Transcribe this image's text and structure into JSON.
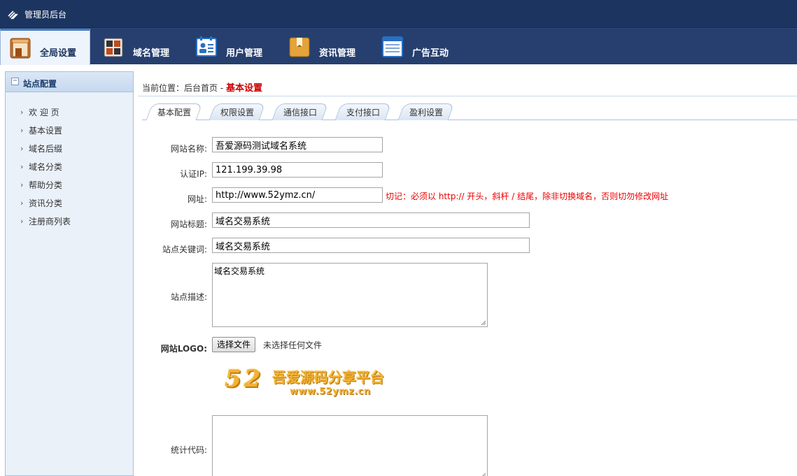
{
  "app": {
    "title": "管理员后台"
  },
  "nav": [
    {
      "label": "全局设置",
      "icon": "cabinet-icon",
      "active": true
    },
    {
      "label": "域名管理",
      "icon": "grid-icon",
      "active": false
    },
    {
      "label": "用户管理",
      "icon": "user-card-icon",
      "active": false
    },
    {
      "label": "资讯管理",
      "icon": "folder-icon",
      "active": false
    },
    {
      "label": "广告互动",
      "icon": "notepad-icon",
      "active": false
    }
  ],
  "sidebar": {
    "title": "站点配置",
    "collapse_symbol": "−",
    "items": [
      {
        "label": "欢 迎 页"
      },
      {
        "label": "基本设置"
      },
      {
        "label": "域名后缀"
      },
      {
        "label": "域名分类"
      },
      {
        "label": "帮助分类"
      },
      {
        "label": "资讯分类"
      },
      {
        "label": "注册商列表"
      }
    ]
  },
  "breadcrumb": {
    "prefix": "当前位置：后台首页 - ",
    "current": "基本设置"
  },
  "tabs": [
    {
      "label": "基本配置",
      "active": true
    },
    {
      "label": "权限设置",
      "active": false
    },
    {
      "label": "通信接口",
      "active": false
    },
    {
      "label": "支付接口",
      "active": false
    },
    {
      "label": "盈利设置",
      "active": false
    }
  ],
  "form": {
    "site_name": {
      "label": "网站名称:",
      "value": "吾爱源码测试域名系统"
    },
    "auth_ip": {
      "label": "认证IP:",
      "value": "121.199.39.98"
    },
    "url": {
      "label": "网址:",
      "value": "http://www.52ymz.cn/",
      "note": "切记：必须以 http:// 开头，斜杆 / 结尾，除非切换域名，否则切勿修改网址"
    },
    "site_title": {
      "label": "网站标题:",
      "value": "域名交易系统"
    },
    "keywords": {
      "label": "站点关键词:",
      "value": "域名交易系统"
    },
    "description": {
      "label": "站点描述:",
      "value": "域名交易系统"
    },
    "logo": {
      "label": "网站LOGO:",
      "button": "选择文件",
      "status": "未选择任何文件",
      "logo_number": "52",
      "logo_text": "吾爱源码分享平台",
      "logo_url": "www.52ymz.cn"
    },
    "stats_code": {
      "label": "统计代码:",
      "value": ""
    }
  }
}
